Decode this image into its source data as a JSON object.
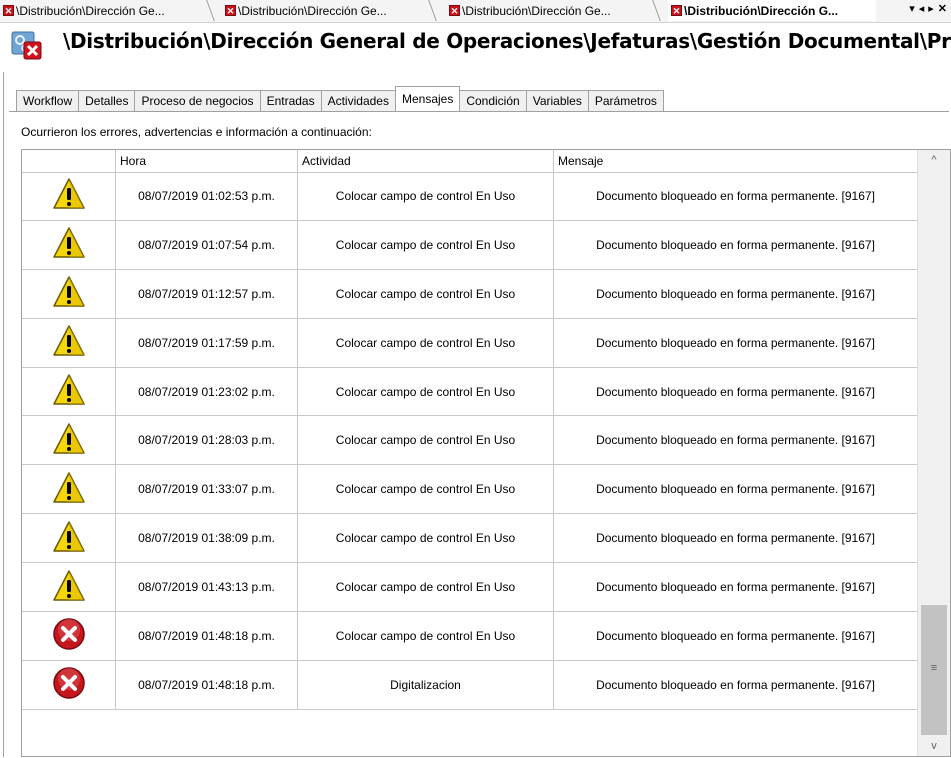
{
  "doc_tabs": [
    {
      "label": "\\Distribución\\Dirección Ge...",
      "active": false
    },
    {
      "label": "\\Distribución\\Dirección Ge...",
      "active": false
    },
    {
      "label": "\\Distribución\\Dirección Ge...",
      "active": false
    },
    {
      "label": "\\Distribución\\Dirección G...",
      "active": true
    }
  ],
  "strip_controls": {
    "menu": "▾",
    "prev": "◂",
    "next": "▸",
    "close": "✕"
  },
  "title": "\\Distribución\\Dirección General de Operaciones\\Jefaturas\\Gestión Documental\\Proc...",
  "tabs": [
    "Workflow",
    "Detalles",
    "Proceso de negocios",
    "Entradas",
    "Actividades",
    "Mensajes",
    "Condición",
    "Variables",
    "Parámetros"
  ],
  "active_tab": "Mensajes",
  "info_text": "Ocurrieron los errores, advertencias e información a continuación:",
  "columns": [
    "",
    "Hora",
    "Actividad",
    "Mensaje"
  ],
  "rows": [
    {
      "icon": "warning-icon",
      "hora": "08/07/2019 01:02:53 p.m.",
      "actividad": "Colocar campo de control En Uso",
      "mensaje": "Documento bloqueado en forma permanente. [9167]"
    },
    {
      "icon": "warning-icon",
      "hora": "08/07/2019 01:07:54 p.m.",
      "actividad": "Colocar campo de control En Uso",
      "mensaje": "Documento bloqueado en forma permanente. [9167]"
    },
    {
      "icon": "warning-icon",
      "hora": "08/07/2019 01:12:57 p.m.",
      "actividad": "Colocar campo de control En Uso",
      "mensaje": "Documento bloqueado en forma permanente. [9167]"
    },
    {
      "icon": "warning-icon",
      "hora": "08/07/2019 01:17:59 p.m.",
      "actividad": "Colocar campo de control En Uso",
      "mensaje": "Documento bloqueado en forma permanente. [9167]"
    },
    {
      "icon": "warning-icon",
      "hora": "08/07/2019 01:23:02 p.m.",
      "actividad": "Colocar campo de control En Uso",
      "mensaje": "Documento bloqueado en forma permanente. [9167]"
    },
    {
      "icon": "warning-icon",
      "hora": "08/07/2019 01:28:03 p.m.",
      "actividad": "Colocar campo de control En Uso",
      "mensaje": "Documento bloqueado en forma permanente. [9167]"
    },
    {
      "icon": "warning-icon",
      "hora": "08/07/2019 01:33:07 p.m.",
      "actividad": "Colocar campo de control En Uso",
      "mensaje": "Documento bloqueado en forma permanente. [9167]"
    },
    {
      "icon": "warning-icon",
      "hora": "08/07/2019 01:38:09 p.m.",
      "actividad": "Colocar campo de control En Uso",
      "mensaje": "Documento bloqueado en forma permanente. [9167]"
    },
    {
      "icon": "warning-icon",
      "hora": "08/07/2019 01:43:13 p.m.",
      "actividad": "Colocar campo de control En Uso",
      "mensaje": "Documento bloqueado en forma permanente. [9167]"
    },
    {
      "icon": "error-icon",
      "hora": "08/07/2019 01:48:18 p.m.",
      "actividad": "Colocar campo de control En Uso",
      "mensaje": "Documento bloqueado en forma permanente. [9167]"
    },
    {
      "icon": "error-icon",
      "hora": "08/07/2019 01:48:18 p.m.",
      "actividad": "Digitalizacion",
      "mensaje": "Documento bloqueado en forma permanente. [9167]"
    }
  ],
  "scrollbar": {
    "up": "^",
    "down": "v",
    "grip": "≡"
  },
  "colors": {
    "warning": "#f5d60a",
    "error": "#c4161c",
    "border": "#a0a0a0"
  }
}
